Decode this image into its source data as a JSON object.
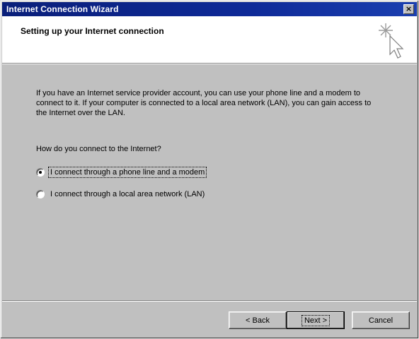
{
  "window": {
    "title": "Internet Connection Wizard",
    "close_symbol": "×"
  },
  "header": {
    "title": "Setting up your Internet connection",
    "icon": "wizard-cursor-sparkle-icon"
  },
  "main": {
    "intro": "If you have an Internet service provider account, you can use your phone line and a modem to connect to it. If your computer is connected to a local area network (LAN), you can gain access to the Internet over the LAN.",
    "question": "How do you connect to the Internet?",
    "options": [
      {
        "label": "I connect through a phone line and a modem",
        "selected": true
      },
      {
        "label": "I connect through a local area network (LAN)",
        "selected": false
      }
    ]
  },
  "buttons": {
    "back": "< Back",
    "next": "Next >",
    "cancel": "Cancel"
  },
  "colors": {
    "titlebar": "#0a1f7a",
    "face": "#c0c0c0",
    "header_bg": "#ffffff"
  }
}
